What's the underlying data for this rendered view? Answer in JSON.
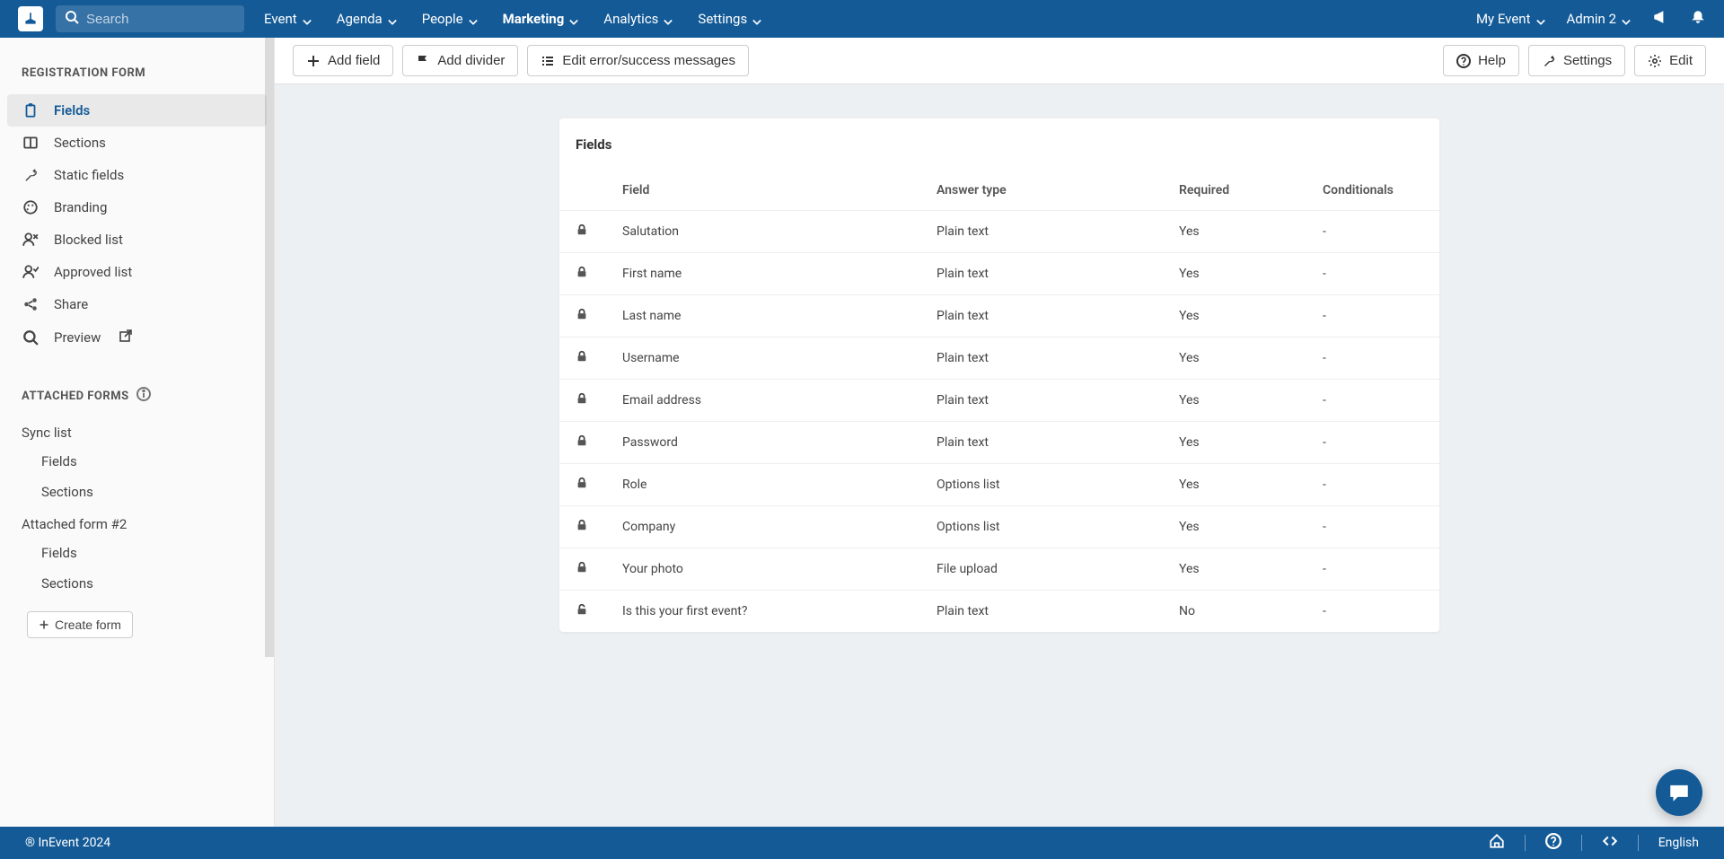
{
  "topbar": {
    "search_placeholder": "Search",
    "menu": [
      {
        "label": "Event",
        "active": false
      },
      {
        "label": "Agenda",
        "active": false
      },
      {
        "label": "People",
        "active": false
      },
      {
        "label": "Marketing",
        "active": true
      },
      {
        "label": "Analytics",
        "active": false
      },
      {
        "label": "Settings",
        "active": false
      }
    ],
    "event_name": "My Event",
    "user_name": "Admin 2"
  },
  "sidebar": {
    "section1_title": "REGISTRATION FORM",
    "items": [
      {
        "label": "Fields",
        "icon": "clipboard-icon",
        "active": true
      },
      {
        "label": "Sections",
        "icon": "columns-icon",
        "active": false
      },
      {
        "label": "Static fields",
        "icon": "wrench-icon",
        "active": false
      },
      {
        "label": "Branding",
        "icon": "palette-icon",
        "active": false
      },
      {
        "label": "Blocked list",
        "icon": "user-x-icon",
        "active": false
      },
      {
        "label": "Approved list",
        "icon": "user-check-icon",
        "active": false
      },
      {
        "label": "Share",
        "icon": "share-icon",
        "active": false
      },
      {
        "label": "Preview",
        "icon": "search-icon",
        "active": false,
        "ext": true
      }
    ],
    "section2_title": "ATTACHED FORMS",
    "forms": [
      {
        "title": "Sync list",
        "subs": [
          "Fields",
          "Sections"
        ]
      },
      {
        "title": "Attached form #2",
        "subs": [
          "Fields",
          "Sections"
        ]
      }
    ],
    "create_form_label": "Create form"
  },
  "actions": {
    "add_field": "Add field",
    "add_divider": "Add divider",
    "edit_messages": "Edit error/success messages",
    "help": "Help",
    "settings": "Settings",
    "edit": "Edit"
  },
  "card": {
    "title": "Fields",
    "columns": {
      "field": "Field",
      "answer": "Answer type",
      "required": "Required",
      "conditionals": "Conditionals"
    },
    "rows": [
      {
        "locked": true,
        "field": "Salutation",
        "answer": "Plain text",
        "required": "Yes",
        "conditionals": "-"
      },
      {
        "locked": true,
        "field": "First name",
        "answer": "Plain text",
        "required": "Yes",
        "conditionals": "-"
      },
      {
        "locked": true,
        "field": "Last name",
        "answer": "Plain text",
        "required": "Yes",
        "conditionals": "-"
      },
      {
        "locked": true,
        "field": "Username",
        "answer": "Plain text",
        "required": "Yes",
        "conditionals": "-"
      },
      {
        "locked": true,
        "field": "Email address",
        "answer": "Plain text",
        "required": "Yes",
        "conditionals": "-"
      },
      {
        "locked": true,
        "field": "Password",
        "answer": "Plain text",
        "required": "Yes",
        "conditionals": "-"
      },
      {
        "locked": true,
        "field": "Role",
        "answer": "Options list",
        "required": "Yes",
        "conditionals": "-"
      },
      {
        "locked": true,
        "field": "Company",
        "answer": "Options list",
        "required": "Yes",
        "conditionals": "-"
      },
      {
        "locked": true,
        "field": "Your photo",
        "answer": "File upload",
        "required": "Yes",
        "conditionals": "-"
      },
      {
        "locked": false,
        "field": "Is this your first event?",
        "answer": "Plain text",
        "required": "No",
        "conditionals": "-"
      }
    ]
  },
  "footer": {
    "copyright": "® InEvent 2024",
    "language": "English"
  }
}
